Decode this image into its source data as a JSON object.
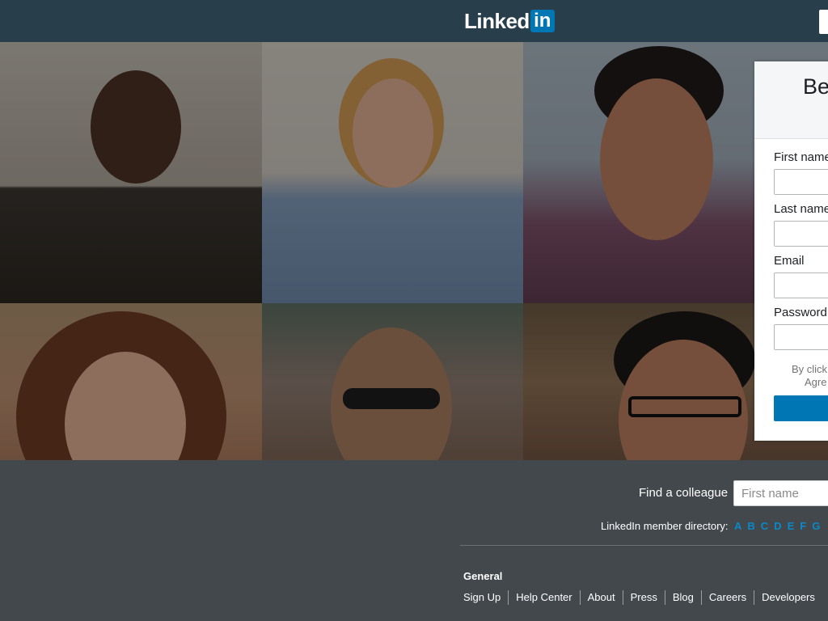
{
  "header": {
    "logo_text": "Linked",
    "logo_badge": "in",
    "brand_color": "#0077b5",
    "bar_color": "#283e4a"
  },
  "join_form": {
    "title": "Be",
    "fields": [
      {
        "label": "First name"
      },
      {
        "label": "Last name"
      },
      {
        "label": "Email"
      },
      {
        "label": "Password"
      }
    ],
    "terms_line1": "By click",
    "terms_line2": "Agre"
  },
  "footer": {
    "find_label": "Find a colleague",
    "find_placeholder": "First name",
    "directory_label": "LinkedIn member directory:",
    "directory_letters": [
      "A",
      "B",
      "C",
      "D",
      "E",
      "F",
      "G"
    ],
    "general_title": "General",
    "links": [
      "Sign Up",
      "Help Center",
      "About",
      "Press",
      "Blog",
      "Careers",
      "Developers"
    ],
    "link_color": "#0a89c7"
  }
}
